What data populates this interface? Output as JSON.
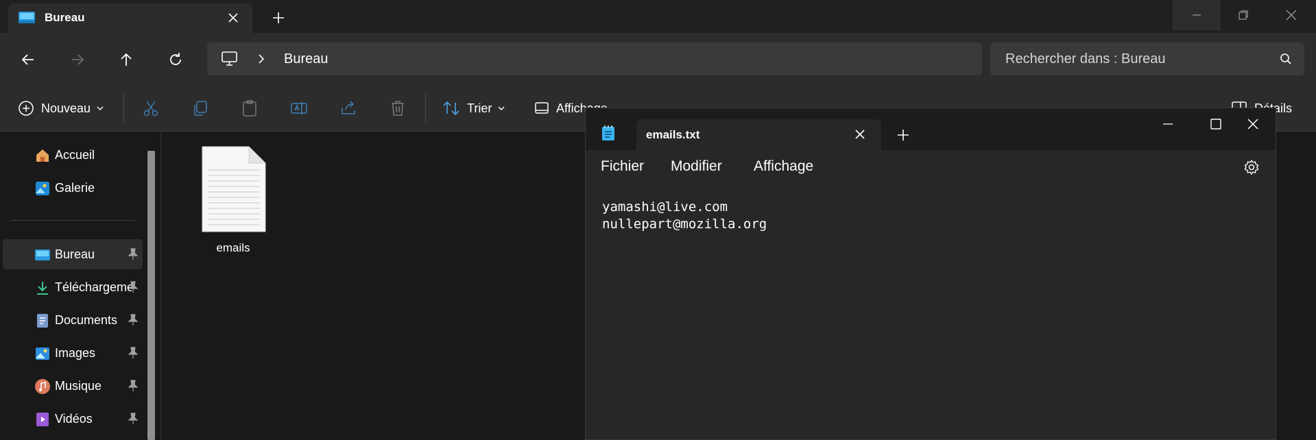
{
  "explorer": {
    "tab_title": "Bureau",
    "breadcrumb": [
      "Bureau"
    ],
    "search_placeholder": "Rechercher dans : Bureau",
    "toolbar": {
      "new_label": "Nouveau",
      "sort_label": "Trier",
      "view_label": "Affichage",
      "details_label": "Détails"
    },
    "sidebar": {
      "top_items": [
        {
          "label": "Accueil",
          "icon": "home-icon"
        },
        {
          "label": "Galerie",
          "icon": "gallery-icon"
        }
      ],
      "pinned_items": [
        {
          "label": "Bureau",
          "icon": "desktop-folder-icon",
          "selected": true
        },
        {
          "label": "Téléchargements",
          "icon": "download-icon"
        },
        {
          "label": "Documents",
          "icon": "documents-icon"
        },
        {
          "label": "Images",
          "icon": "pictures-icon"
        },
        {
          "label": "Musique",
          "icon": "music-icon"
        },
        {
          "label": "Vidéos",
          "icon": "videos-icon"
        }
      ]
    },
    "files": [
      {
        "name": "emails",
        "icon": "text-file-icon"
      }
    ]
  },
  "notepad": {
    "tab_title": "emails.txt",
    "menu": [
      "Fichier",
      "Modifier",
      "Affichage"
    ],
    "content_lines": [
      "yamashi@live.com",
      "nullepart@mozilla.org"
    ]
  }
}
